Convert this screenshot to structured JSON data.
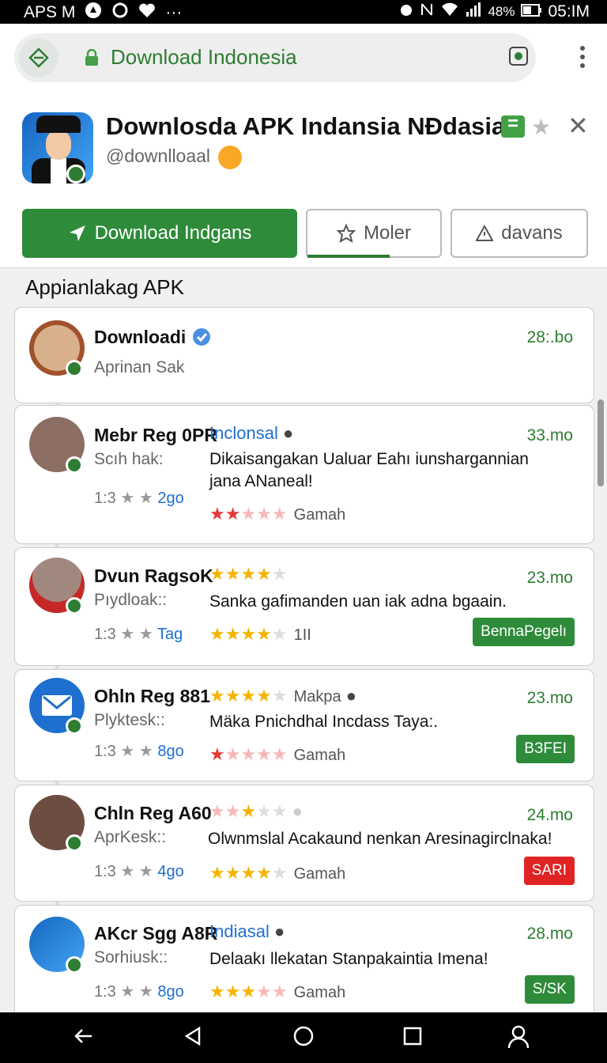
{
  "status_bar": {
    "left_text": "APS M",
    "battery": "48%",
    "time": "05:IM"
  },
  "browser": {
    "url": "Download Indonesia"
  },
  "app": {
    "title": "Downlosda APK Indansia NĐdasia",
    "handle": "@downlloaal",
    "buttons": {
      "download": "Download Indgans",
      "more": "Moler",
      "advanced": "davans"
    }
  },
  "section_title": "Appianlakag APK",
  "items": [
    {
      "name": "Downloadi",
      "sub": "Aprinan Sak",
      "time": "28:.bo"
    },
    {
      "name": "Mebr Reg 0PR",
      "tag": "Inclonsal",
      "time": "33.mo",
      "sub": "Scıh hak:",
      "message": "Dikaisangakan Ualuar Eahı iunshargannian jana ANaneal!",
      "meta_num": "1:3",
      "meta_link": "2go",
      "rating_label": "Gamah",
      "rating": 1.5
    },
    {
      "name": "Dvun RagsoK",
      "time": "23.mo",
      "sub": "Pıydloak::",
      "message": "Sanka gafimanden uan iak adna bgaain.",
      "meta_num": "1:3",
      "meta_link": "Tag",
      "rating_label": "1II",
      "rating": 3.5,
      "top_rating": 3.5,
      "pill": "BennaPegelı"
    },
    {
      "name": "Ohln Reg 881",
      "time": "23.mo",
      "top_label": "Makpa",
      "sub": "Plyktesk::",
      "message": "Mäka Pnichdhal Incdass Taya:.",
      "meta_num": "1:3",
      "meta_link": "8go",
      "rating_label": "Gamah",
      "rating": 1.5,
      "top_rating": 3.5,
      "pill": "BЗFEI"
    },
    {
      "name": "Chln Reg A60",
      "time": "24.mo",
      "sub": "AprKesk::",
      "message": "Olwnmslal Acakaund nenkan Aresinagirclnaka!",
      "meta_num": "1:3",
      "meta_link": "4go",
      "rating_label": "Gamah",
      "rating": 3.5,
      "top_rating": 2.5,
      "pill": "SARI"
    },
    {
      "name": "AKcr Sgg A8R",
      "tag": "Indiasal",
      "time": "28.mo",
      "sub": "Sorhiusk::",
      "message": "Delaakı llekatan Stanpakaintia Imena!",
      "meta_num": "1:3",
      "meta_link": "8go",
      "rating_label": "Gamah",
      "rating": 3.5,
      "pill": "S/SK"
    }
  ],
  "colors": {
    "brand_green": "#2e8b3a",
    "link_blue": "#1e6fd0",
    "pill_red": "#e02424"
  }
}
